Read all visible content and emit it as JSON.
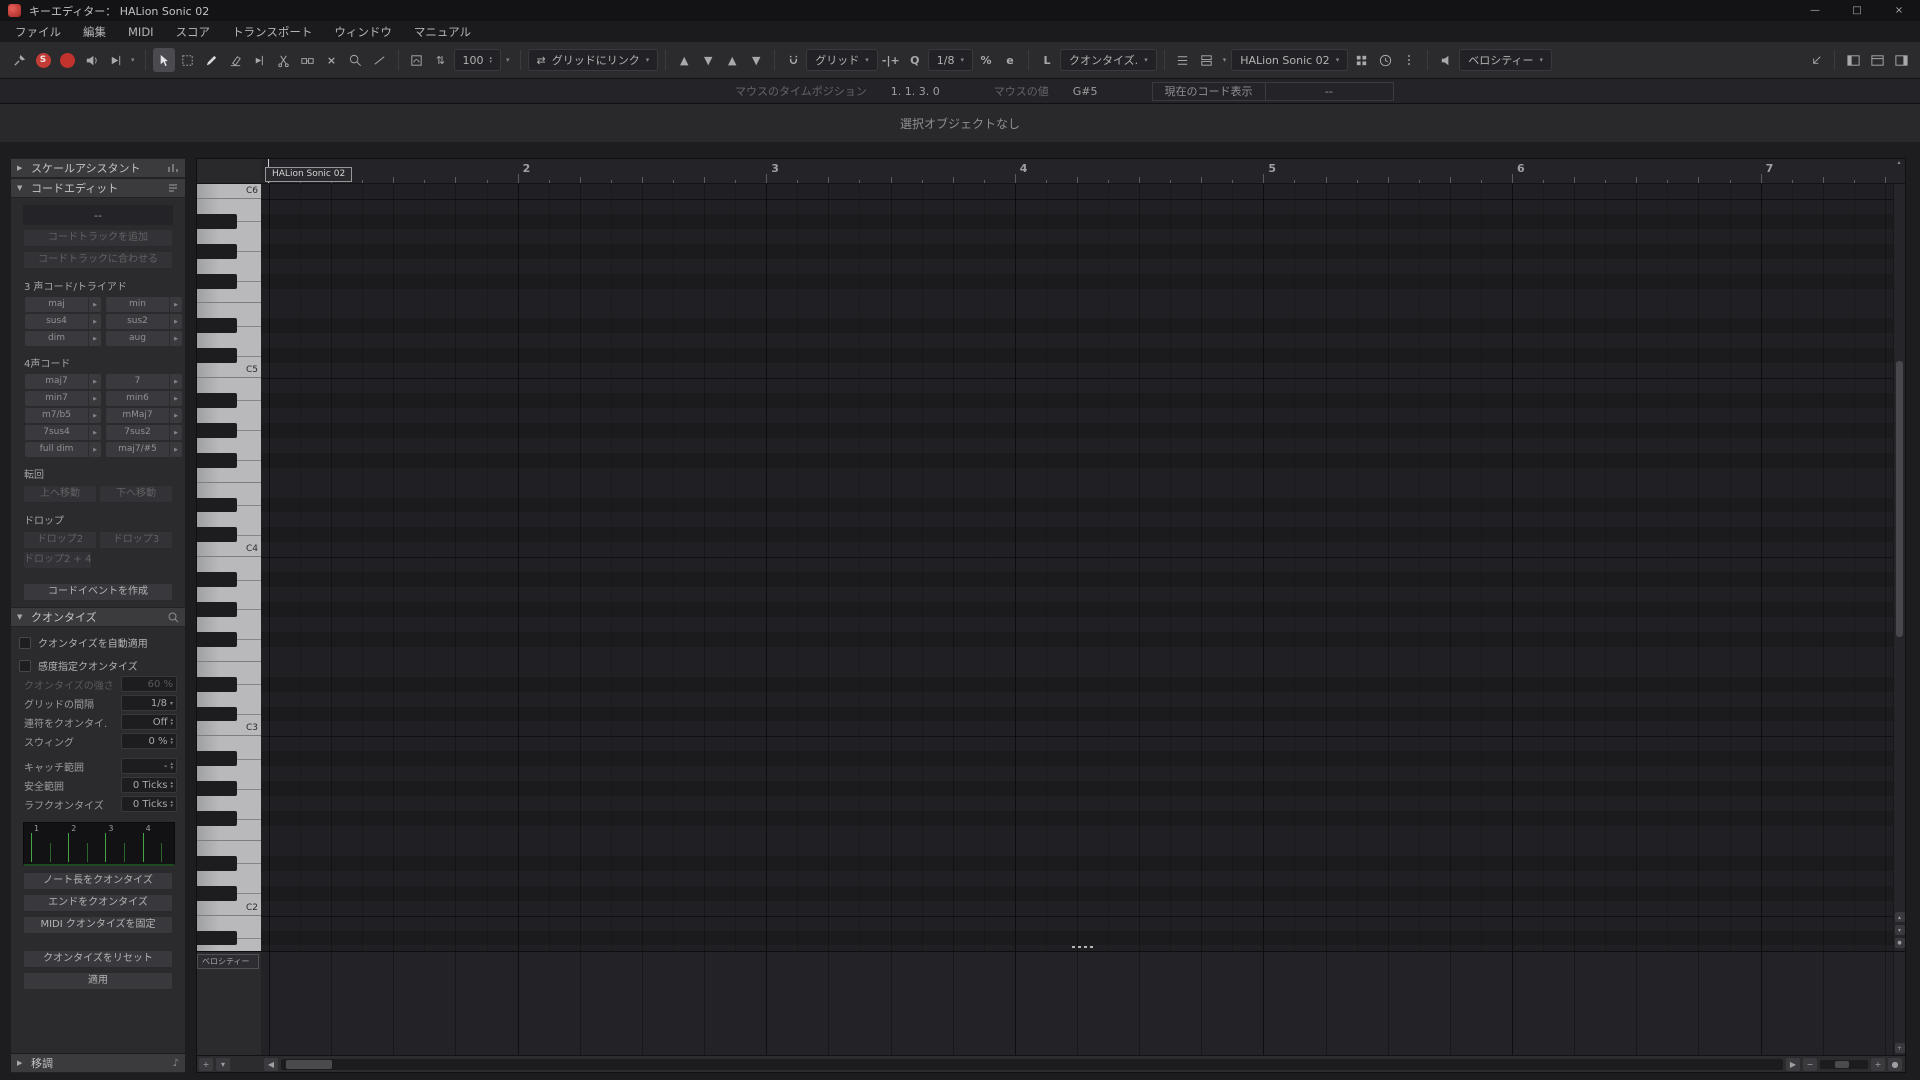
{
  "titlebar": {
    "title": "キーエディター： HALion Sonic 02"
  },
  "menubar": {
    "items": [
      "ファイル",
      "編集",
      "MIDI",
      "スコア",
      "トランスポート",
      "ウィンドウ",
      "マニュアル"
    ]
  },
  "toolbar": {
    "solo_letter": "S",
    "insert_velocity": "100",
    "link_grid_label": "グリッドにリンク",
    "grid_type_label": "グリッド",
    "nudge_label": "-|+",
    "quantize_letter": "Q",
    "quantize_value": "1/8",
    "iterative_label": "%",
    "panel_letter": "e",
    "length_q_letter": "L",
    "quantize_mode_label": "クオンタイズ.",
    "part_selector": "HALion Sonic 02",
    "event_colors_label": "ベロシティー"
  },
  "infoline": {
    "mouse_time_label": "マウスのタイムポジション",
    "mouse_time_value": "1. 1. 3. 0",
    "mouse_pitch_label": "マウスの値",
    "mouse_pitch_value": "G#5",
    "chord_display_label": "現在のコード表示",
    "chord_display_value": "--"
  },
  "statusline": {
    "text": "選択オブジェクトなし"
  },
  "inspector": {
    "sections": {
      "scale_assistant": "スケールアシスタント",
      "chord_edit": "コードエディット",
      "quantize": "クオンタイズ",
      "transpose": "移調"
    },
    "chord_edit": {
      "current_chord": "--",
      "add_chord_track": "コードトラックを追加",
      "match_chord_track": "コードトラックに合わせる",
      "triads_label": "3 声コード/トライアド",
      "triads": [
        "maj",
        "min",
        "sus4",
        "sus2",
        "dim",
        "aug"
      ],
      "four_note_label": "4声コード",
      "four_note": [
        "maj7",
        "7",
        "min7",
        "min6",
        "m7/b5",
        "mMaj7",
        "7sus4",
        "7sus2",
        "full dim",
        "maj7/#5"
      ],
      "inversion_label": "転回",
      "move_up": "上へ移動",
      "move_down": "下へ移動",
      "drop_label": "ドロップ",
      "drop2": "ドロップ2",
      "drop3": "ドロップ3",
      "drop24": "ドロップ2 + 4",
      "create_chord_event": "コードイベントを作成"
    },
    "quantize": {
      "auto_apply": "クオンタイズを自動適用",
      "soft_quantize": "感度指定クオンタイズ",
      "strength_label": "クオンタイズの強さ",
      "strength_value": "60 %",
      "grid_label": "グリッドの間隔",
      "grid_value": "1/8",
      "tuplet_label": "連符をクオンタイ.",
      "tuplet_value": "Off",
      "swing_label": "スウィング",
      "swing_value": "0 %",
      "catch_label": "キャッチ範囲",
      "catch_value": "-",
      "safe_label": "安全範囲",
      "safe_value": "0 Ticks",
      "rough_label": "ラフクオンタイズ",
      "rough_value": "0 Ticks",
      "beat_numbers": [
        "1",
        "2",
        "3",
        "4"
      ],
      "quantize_lengths": "ノート長をクオンタイズ",
      "quantize_ends": "エンドをクオンタイズ",
      "freeze_quantize": "MIDI クオンタイズを固定",
      "reset_quantize": "クオンタイズをリセット",
      "apply": "適用"
    }
  },
  "editor": {
    "part_name": "HALion Sonic 02",
    "ruler_bars": [
      "2",
      "3",
      "4",
      "5",
      "6",
      "7"
    ],
    "octave_labels": [
      "C6",
      "C5",
      "C4",
      "C3",
      "C2"
    ],
    "velocity_label": "ベロシティー"
  },
  "icons": {
    "expand": "▶",
    "collapse": "▼",
    "play": "▶",
    "dropdown": "▾",
    "up": "▲",
    "down": "▼",
    "up_small": "▴",
    "down_small": "▾",
    "left": "◀",
    "right": "▶",
    "minimize": "—",
    "maximize": "□",
    "close": "×",
    "plus": "+",
    "minus": "−",
    "dot": "●",
    "note": "♪",
    "link": "⇄",
    "updown": "⇅",
    "mute": "×"
  }
}
